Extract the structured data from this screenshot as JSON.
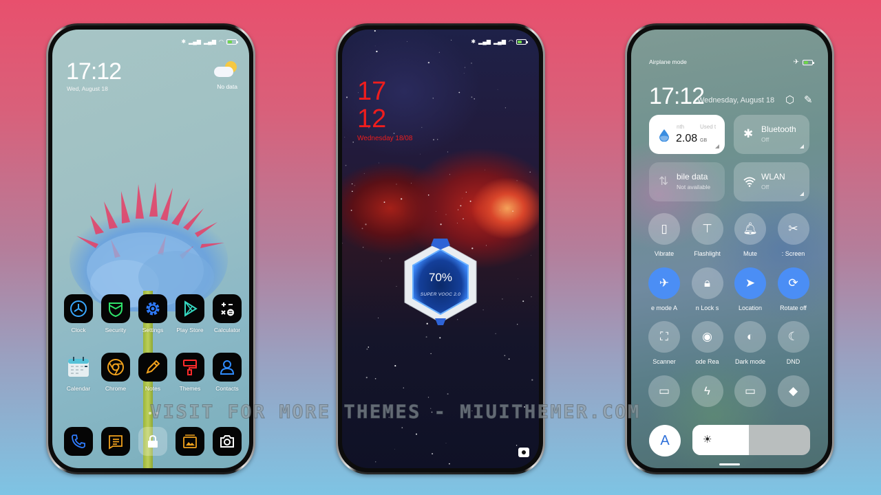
{
  "background": {
    "top_color": "#e8506d",
    "bottom_color": "#7ec4e4"
  },
  "watermark": "VISIT FOR MORE THEMES - MIUITHEMER.COM",
  "home_screen": {
    "status_icons": [
      "bluetooth-icon",
      "hd-signal-icon",
      "hd-signal-icon",
      "wifi-icon",
      "battery-icon"
    ],
    "time": "17:12",
    "date": "Wed, August 18",
    "weather": {
      "icon": "partly-cloudy-icon",
      "text": "No data"
    },
    "apps_row1": [
      {
        "label": "Clock",
        "icon": "clock-icon",
        "color": "#39a8ff"
      },
      {
        "label": "Security",
        "icon": "shield-icon",
        "color": "#2fe36b"
      },
      {
        "label": "Settings",
        "icon": "gear-icon",
        "color": "#2f7cff"
      },
      {
        "label": "Play Store",
        "icon": "play-store-icon",
        "color": "#35d7c0"
      },
      {
        "label": "Calculator",
        "icon": "calculator-icon",
        "color": "#ffffff"
      }
    ],
    "apps_row2": [
      {
        "label": "Calendar",
        "icon": "calendar-icon",
        "color": "#56c2d8"
      },
      {
        "label": "Chrome",
        "icon": "chrome-icon",
        "color": "#f2a21d"
      },
      {
        "label": "Notes",
        "icon": "pencil-icon",
        "color": "#f2a21d"
      },
      {
        "label": "Themes",
        "icon": "paint-roller-icon",
        "color": "#ff2a2a"
      },
      {
        "label": "Contacts",
        "icon": "contact-icon",
        "color": "#2f8cff"
      }
    ],
    "dock": [
      {
        "icon": "phone-icon",
        "color": "#2f7cff"
      },
      {
        "icon": "messages-icon",
        "color": "#f2a21d"
      },
      {
        "icon": "lock-icon",
        "color": "#ffffff"
      },
      {
        "icon": "gallery-icon",
        "color": "#f2a21d"
      },
      {
        "icon": "camera-icon",
        "color": "#ffffff"
      }
    ],
    "page_dots": 2,
    "active_page": 2
  },
  "lock_screen": {
    "status_icons": [
      "bluetooth-icon",
      "hd-signal-icon",
      "hd-signal-icon",
      "wifi-icon",
      "battery-icon"
    ],
    "hour": "17",
    "minute": "12",
    "date": "Wednesday 18/08",
    "clock_color": "#ef1d1d",
    "charging": {
      "percent_text": "70%",
      "percent": 70,
      "brand": "SUPER VOOC 2.0"
    },
    "camera_shortcut": "camera-icon"
  },
  "control_center": {
    "carrier_text": "Airplane mode",
    "status_icons": [
      "airplane-icon",
      "battery-icon"
    ],
    "time": "17:12",
    "date": "Wednesday, August 18",
    "header_icons": [
      "settings-hex-icon",
      "edit-icon"
    ],
    "tiles": [
      {
        "id": "data-usage",
        "label_left": "nth",
        "label_right": "Used t",
        "value": "2.08",
        "unit": "GB",
        "icon": "water-drop-icon",
        "style": "white"
      },
      {
        "id": "bluetooth",
        "title": "Bluetooth",
        "subtitle": "Off",
        "icon": "bluetooth-icon"
      },
      {
        "id": "mobile-data",
        "title": "bile data",
        "subtitle": "Not available",
        "icon": "data-arrows-icon"
      },
      {
        "id": "wlan",
        "title": "WLAN",
        "subtitle": "Off",
        "icon": "wifi-icon"
      }
    ],
    "toggles": [
      {
        "label": "Vibrate",
        "icon": "vibrate-icon",
        "on": false
      },
      {
        "label": "Flashlight",
        "icon": "flashlight-icon",
        "on": false
      },
      {
        "label": "Mute",
        "icon": "bell-icon",
        "on": false
      },
      {
        "label": ":     Screen",
        "icon": "screenshot-icon",
        "on": false
      },
      {
        "label": "e mode    A",
        "icon": "airplane-icon",
        "on": true
      },
      {
        "label": "n    Lock s",
        "icon": "lock-icon",
        "on": false
      },
      {
        "label": "Location",
        "icon": "location-icon",
        "on": true
      },
      {
        "label": "Rotate off",
        "icon": "rotate-lock-icon",
        "on": true
      },
      {
        "label": "Scanner",
        "icon": "scanner-icon",
        "on": false
      },
      {
        "label": "ode    Rea",
        "icon": "eye-icon",
        "on": false
      },
      {
        "label": "Dark mode",
        "icon": "dark-mode-icon",
        "on": false
      },
      {
        "label": "DND",
        "icon": "moon-icon",
        "on": false
      },
      {
        "label": "",
        "icon": "battery-saver-icon",
        "on": false
      },
      {
        "label": "",
        "icon": "bolt-icon",
        "on": false
      },
      {
        "label": "",
        "icon": "cast-screen-icon",
        "on": false
      },
      {
        "label": "",
        "icon": "nearby-share-icon",
        "on": false
      }
    ],
    "auto_brightness_label": "A",
    "brightness_percent": 48,
    "on_color": "#4b8ef5"
  }
}
